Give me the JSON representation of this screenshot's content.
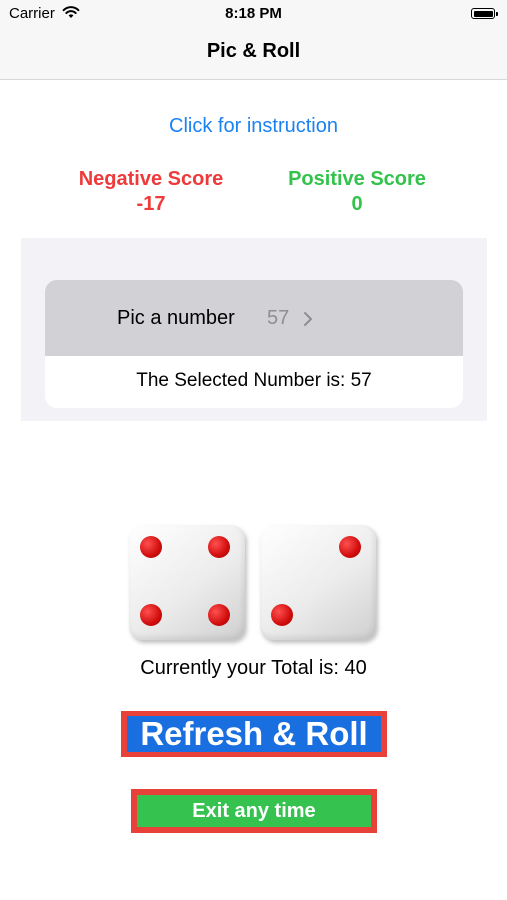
{
  "status_bar": {
    "carrier": "Carrier",
    "time": "8:18 PM"
  },
  "nav": {
    "title": "Pic & Roll"
  },
  "instruction_link": "Click for instruction",
  "scores": {
    "negative": {
      "label": "Negative Score",
      "value": "-17"
    },
    "positive": {
      "label": "Positive Score",
      "value": "0"
    }
  },
  "picker": {
    "label": "Pic a number",
    "value": "57",
    "selected_text": "The Selected Number is: 57"
  },
  "dice": {
    "die1": 4,
    "die2": 2
  },
  "total_text": "Currently your Total is: 40",
  "buttons": {
    "roll": "Refresh & Roll",
    "exit": "Exit any time"
  },
  "colors": {
    "link": "#1b82f1",
    "negative": "#ee3a3a",
    "positive": "#33c24b",
    "roll_bg": "#1a6fe0",
    "exit_bg": "#35c24f",
    "border": "#e8413a"
  }
}
